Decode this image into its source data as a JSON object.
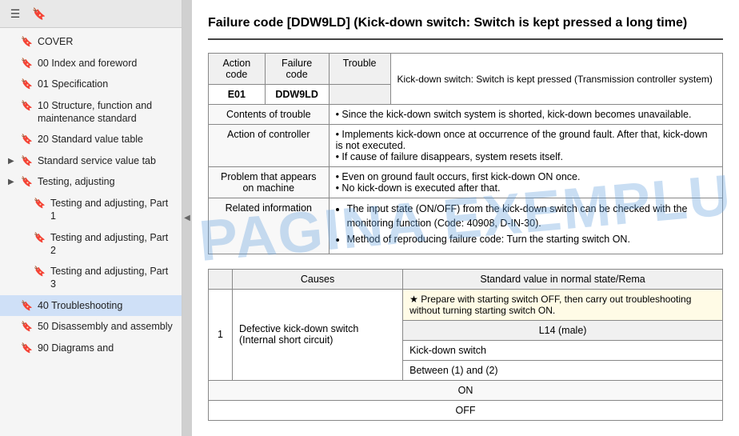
{
  "sidebar": {
    "items": [
      {
        "id": "cover",
        "label": "COVER",
        "indent": 0,
        "expandable": false
      },
      {
        "id": "00-index",
        "label": "00 Index and foreword",
        "indent": 0,
        "expandable": false
      },
      {
        "id": "01-spec",
        "label": "01 Specification",
        "indent": 0,
        "expandable": false
      },
      {
        "id": "10-structure",
        "label": "10 Structure, function and maintenance standard",
        "indent": 0,
        "expandable": false
      },
      {
        "id": "20-standard",
        "label": "20 Standard value table",
        "indent": 0,
        "expandable": false
      },
      {
        "id": "standard-service",
        "label": "Standard service value tab",
        "indent": 0,
        "expandable": true,
        "expanded": false
      },
      {
        "id": "testing-adjusting",
        "label": "Testing, adjusting",
        "indent": 0,
        "expandable": true,
        "expanded": false
      },
      {
        "id": "testing-part1",
        "label": "Testing and adjusting, Part 1",
        "indent": 1,
        "expandable": false
      },
      {
        "id": "testing-part2",
        "label": "Testing and adjusting, Part 2",
        "indent": 1,
        "expandable": false
      },
      {
        "id": "testing-part3",
        "label": "Testing and adjusting, Part 3",
        "indent": 1,
        "expandable": false
      },
      {
        "id": "40-troubleshooting",
        "label": "40 Troubleshooting",
        "indent": 0,
        "expandable": false,
        "active": true
      },
      {
        "id": "50-disassembly",
        "label": "50 Disassembly and assembly",
        "indent": 0,
        "expandable": false
      },
      {
        "id": "90-diagrams",
        "label": "90 Diagrams and",
        "indent": 0,
        "expandable": false
      }
    ]
  },
  "main": {
    "title": "Failure code [DDW9LD] (Kick-down switch: Switch is kept pressed a long time)",
    "info_table": {
      "headers": [
        "Action code",
        "Failure code",
        "Trouble"
      ],
      "action_code": "E01",
      "failure_code": "DDW9LD",
      "trouble_desc": "Kick-down switch: Switch is kept pressed (Transmission controller system)",
      "rows": [
        {
          "label": "Contents of trouble",
          "content": "Since the kick-down switch system is shorted, kick-down becomes unavailable."
        },
        {
          "label": "Action of controller",
          "content": "Implements kick-down once at occurrence of the ground fault. After that, kick-down is not executed.\nIf cause of failure disappears, system resets itself."
        },
        {
          "label": "Problem that appears on machine",
          "content": "Even on ground fault occurs, first kick-down ON once.\nNo kick-down is executed after that."
        },
        {
          "label": "Related information",
          "content_bullets": [
            "The input state (ON/OFF) from the kick-down switch can be checked with the monitoring function (Code: 40908, D-IN-30).",
            "Method of reproducing failure code: Turn the starting switch ON."
          ]
        }
      ]
    },
    "causes_table": {
      "headers": [
        "",
        "Causes",
        "Standard value in normal state/Rema"
      ],
      "rows": [
        {
          "number": "1",
          "cause": "Defective kick-down switch (Internal short circuit)",
          "sub_rows": [
            {
              "label": "★ Prepare with starting switch OFF, then carry out troubleshooting without turning starting switch ON.",
              "is_note": true
            },
            {
              "connector": "L14 (male)",
              "measurement": "Kick-down switch",
              "value_on": "ON",
              "value_off": "OFF"
            },
            {
              "connector": "Between (1) and (2)",
              "measurement": "",
              "value_on": "ON",
              "value_off": "OFF"
            }
          ]
        }
      ]
    }
  },
  "watermark": "PAGINA EXEMPLU",
  "icons": {
    "bookmark": "🔖",
    "expand": "▶",
    "collapse": "◀",
    "toolbar_list": "☰",
    "toolbar_bookmark": "🔖"
  }
}
